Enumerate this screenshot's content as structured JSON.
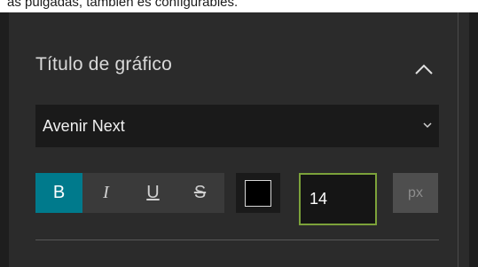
{
  "top_strip": {
    "text": "as pulgadas, también es configurables."
  },
  "section": {
    "title": "Título de gráfico",
    "collapse_icon": "chevron-up-icon"
  },
  "font_select": {
    "value": "Avenir Next",
    "arrow_icon": "chevron-down-icon"
  },
  "style_buttons": [
    {
      "label": "B",
      "name": "bold",
      "active": true
    },
    {
      "label": "I",
      "name": "italic",
      "active": false
    },
    {
      "label": "U",
      "name": "underline",
      "active": false
    },
    {
      "label": "S",
      "name": "strikethrough",
      "active": false
    }
  ],
  "color": {
    "value": "#000000"
  },
  "font_size": {
    "value": "14",
    "unit": "px"
  },
  "colors": {
    "panel_bg": "#2b2b2b",
    "active": "#007a8c",
    "focus_border": "#7ca23a"
  }
}
